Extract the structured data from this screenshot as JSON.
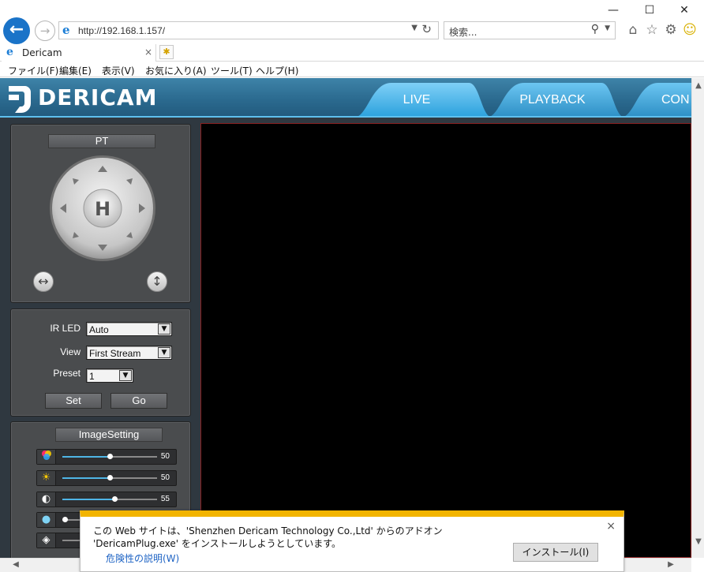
{
  "window": {
    "minimize_glyph": "—",
    "maximize_glyph": "☐",
    "close_glyph": "✕"
  },
  "address_bar": {
    "url": "http://192.168.1.157/",
    "search_placeholder": "検索..."
  },
  "tab": {
    "title": "Dericam",
    "close_glyph": "×"
  },
  "menu": {
    "items": [
      "ファイル(F)",
      "編集(E)",
      "表示(V)",
      "お気に入り(A)",
      "ツール(T)",
      "ヘルプ(H)"
    ]
  },
  "site": {
    "logo_text": "DERICAM",
    "nav_tabs": [
      "LIVE",
      "PLAYBACK",
      "CON"
    ]
  },
  "pt_panel": {
    "title": "PT",
    "home_label": "H"
  },
  "controls_panel": {
    "ir_led_label": "IR LED",
    "ir_led_value": "Auto",
    "view_label": "View",
    "view_value": "First Stream",
    "preset_label": "Preset",
    "preset_value": "1",
    "set_button": "Set",
    "go_button": "Go"
  },
  "image_panel": {
    "title": "ImageSetting",
    "sliders": [
      {
        "icon": "color-saturation-icon",
        "value": "50",
        "level": 0.5
      },
      {
        "icon": "brightness-icon",
        "value": "50",
        "level": 0.5
      },
      {
        "icon": "contrast-icon",
        "value": "55",
        "level": 0.55
      },
      {
        "icon": "hue-icon",
        "value": "",
        "level": 0.0
      },
      {
        "icon": "sharpness-icon",
        "value": "",
        "level": 0.0
      }
    ]
  },
  "notification": {
    "message": "この Web サイトは、'Shenzhen Dericam Technology Co.,Ltd' からのアドオン 'DericamPlug.exe' をインストールしようとしています。",
    "link": "危険性の説明(W)",
    "install_button": "インストール(I)",
    "close_glyph": "×"
  },
  "colors": {
    "browser_back": "#1a73c8",
    "header_blue": "#2b6a8f",
    "nav_tab_blue": "#4fb8e8",
    "panel_gray": "#4a4c4e",
    "notify_accent": "#f2b400"
  }
}
